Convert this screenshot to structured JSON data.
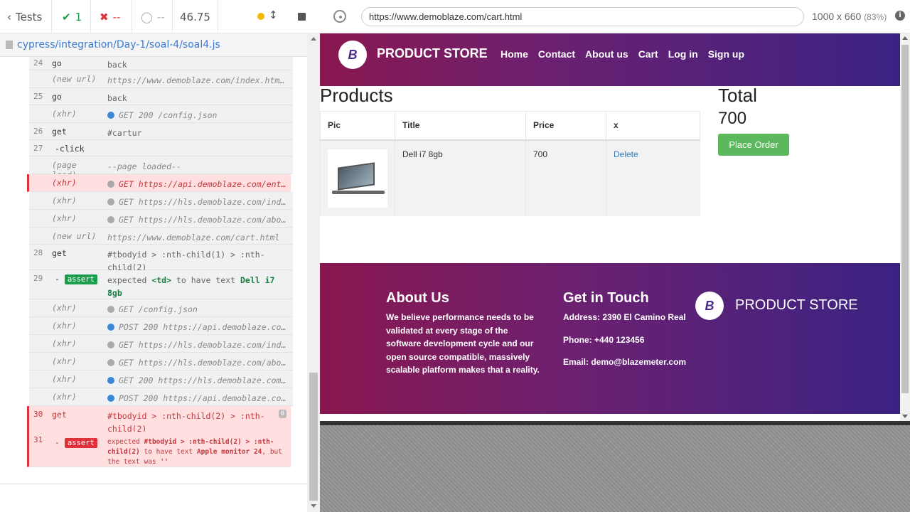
{
  "reporter": {
    "tests_label": "Tests",
    "passed": "1",
    "failed": "--",
    "pending": "--",
    "duration": "46.75",
    "spec_path": "cypress/integration/Day-1/soal-4/soal4.js"
  },
  "commands": [
    {
      "num": "24",
      "name": "go",
      "msg": "back"
    },
    {
      "num": "",
      "name": "(new url)",
      "msg": "https://www.demoblaze.com/index.html#"
    },
    {
      "num": "25",
      "name": "go",
      "msg": "back"
    },
    {
      "num": "",
      "name": "(xhr)",
      "msg": "GET 200 /config.json"
    },
    {
      "num": "26",
      "name": "get",
      "msg": "#cartur"
    },
    {
      "num": "27",
      "name": "-click",
      "msg": ""
    },
    {
      "num": "",
      "name": "(page load)",
      "msg": "--page loaded--"
    },
    {
      "num": "",
      "name": "(xhr)",
      "msg": "GET https://api.demoblaze.com/entr..."
    },
    {
      "num": "",
      "name": "(xhr)",
      "msg": "GET https://hls.demoblaze.com/inde..."
    },
    {
      "num": "",
      "name": "(xhr)",
      "msg": "GET https://hls.demoblaze.com/abou..."
    },
    {
      "num": "",
      "name": "(new url)",
      "msg": "https://www.demoblaze.com/cart.html"
    },
    {
      "num": "28",
      "name": "get",
      "msg": "#tbodyid > :nth-child(1) > :nth-child(2)"
    },
    {
      "num": "29",
      "name": "assert",
      "msg_pre": "expected",
      "msg_td": "<td>",
      "msg_mid": "to have text",
      "msg_val": "Dell i7 8gb"
    },
    {
      "num": "",
      "name": "(xhr)",
      "msg": "GET /config.json"
    },
    {
      "num": "",
      "name": "(xhr)",
      "msg": "POST 200 https://api.demoblaze.com..."
    },
    {
      "num": "",
      "name": "(xhr)",
      "msg": "GET https://hls.demoblaze.com/inde..."
    },
    {
      "num": "",
      "name": "(xhr)",
      "msg": "GET https://hls.demoblaze.com/abou..."
    },
    {
      "num": "",
      "name": "(xhr)",
      "msg": "GET 200 https://hls.demoblaze.com/..."
    },
    {
      "num": "",
      "name": "(xhr)",
      "msg": "POST 200 https://api.demoblaze.com..."
    },
    {
      "num": "30",
      "name": "get",
      "msg": "#tbodyid > :nth-child(2) > :nth-child(2)",
      "badge": "0"
    },
    {
      "num": "31",
      "name": "assert",
      "msg_pre": "expected",
      "msg_sel": "#tbodyid > :nth-child(2) > :nth-child(2)",
      "msg_mid": "to have text",
      "msg_val": "Apple monitor 24",
      "msg_post": ", but the text was",
      "msg_end": "''"
    }
  ],
  "browser": {
    "url": "https://www.demoblaze.com/cart.html",
    "viewport": "1000 x 660",
    "zoom": "(83%)"
  },
  "site": {
    "brand": "PRODUCT STORE",
    "logo_letter": "B",
    "nav": [
      "Home",
      "Contact",
      "About us",
      "Cart",
      "Log in",
      "Sign up"
    ],
    "products_title": "Products",
    "total_title": "Total",
    "total_value": "700",
    "place_order": "Place Order",
    "table_headers": [
      "Pic",
      "Title",
      "Price",
      "x"
    ],
    "row": {
      "title": "Dell i7 8gb",
      "price": "700",
      "delete": "Delete"
    },
    "footer": {
      "about_title": "About Us",
      "about_text": "We believe performance needs to be validated at every stage of the software development cycle and our open source compatible, massively scalable platform makes that a reality.",
      "touch_title": "Get in Touch",
      "address": "Address: 2390 El Camino Real",
      "phone": "Phone: +440 123456",
      "email": "Email: demo@blazemeter.com",
      "brand": "PRODUCT STORE"
    }
  }
}
